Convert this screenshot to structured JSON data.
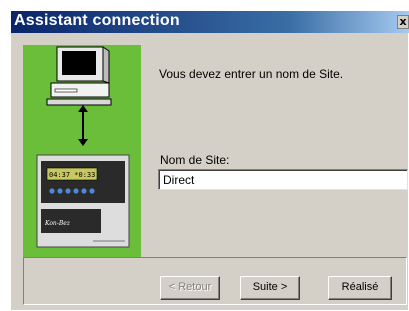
{
  "window": {
    "title": "Assistant connection",
    "close_glyph": "x"
  },
  "illustration": {
    "description_icon": "computer-to-controller-connection-icon",
    "panel_color": "#6abe3a",
    "controller_display_text": "04:37 *0:33",
    "controller_brand": "Kon-Bez"
  },
  "content": {
    "prompt": "Vous devez entrer un nom de Site.",
    "site_label": "Nom de Site:",
    "site_value": "Direct"
  },
  "buttons": {
    "back_label": "< Retour",
    "next_label": "Suite >",
    "done_label": "Réalisé"
  },
  "colors": {
    "titlebar_start": "#0a246a",
    "titlebar_end": "#a6caf0",
    "dialog_bg": "#d4d0c8"
  }
}
